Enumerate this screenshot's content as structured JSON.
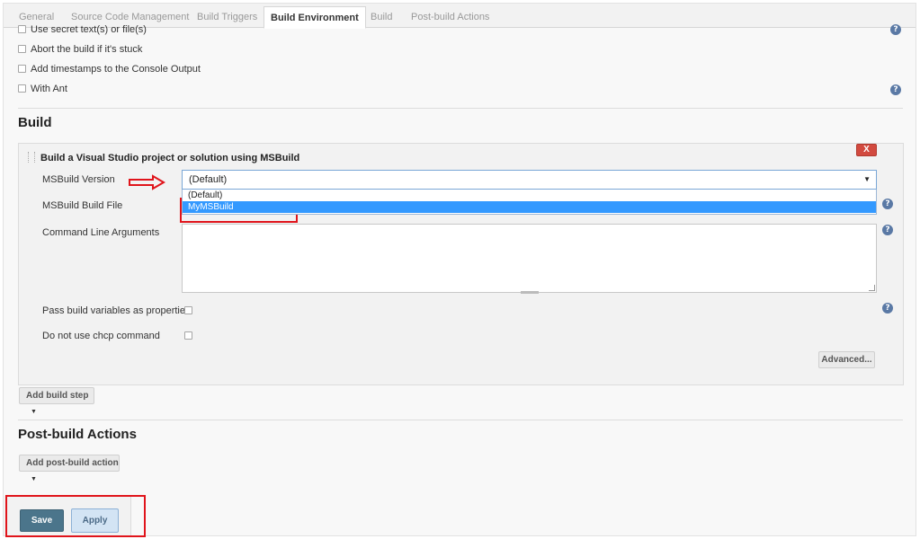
{
  "tabs": [
    {
      "label": "General",
      "active": false
    },
    {
      "label": "Source Code Management",
      "active": false
    },
    {
      "label": "Build Triggers",
      "active": false
    },
    {
      "label": "Build Environment",
      "active": true
    },
    {
      "label": "Build",
      "active": false
    },
    {
      "label": "Post-build Actions",
      "active": false
    }
  ],
  "build_environment": {
    "options": [
      {
        "label": "Use secret text(s) or file(s)",
        "checked": false
      },
      {
        "label": "Abort the build if it's stuck",
        "checked": false
      },
      {
        "label": "Add timestamps to the Console Output",
        "checked": false
      },
      {
        "label": "With Ant",
        "checked": false
      }
    ]
  },
  "build": {
    "title": "Build",
    "step": {
      "title": "Build a Visual Studio project or solution using MSBuild",
      "delete_label": "X",
      "msbuild_version_label": "MSBuild Version",
      "msbuild_version_value": "(Default)",
      "msbuild_version_options": [
        "(Default)",
        "MyMSBuild"
      ],
      "msbuild_version_highlighted": "MyMSBuild",
      "build_file_label": "MSBuild Build File",
      "command_line_label": "Command Line Arguments",
      "pass_vars_label": "Pass build variables as properties",
      "no_chcp_label": "Do not use chcp command",
      "advanced_label": "Advanced..."
    },
    "add_step_label": "Add build step"
  },
  "post_build": {
    "title": "Post-build Actions",
    "add_action_label": "Add post-build action"
  },
  "footer": {
    "save_label": "Save",
    "apply_label": "Apply"
  },
  "help_glyph": "?",
  "colors": {
    "annotation_red": "#e0141b",
    "save_bg": "#4b758b",
    "apply_bg": "#d3e4f4",
    "dropdown_selected": "#3399ff",
    "delete_red": "#d24a3f"
  }
}
